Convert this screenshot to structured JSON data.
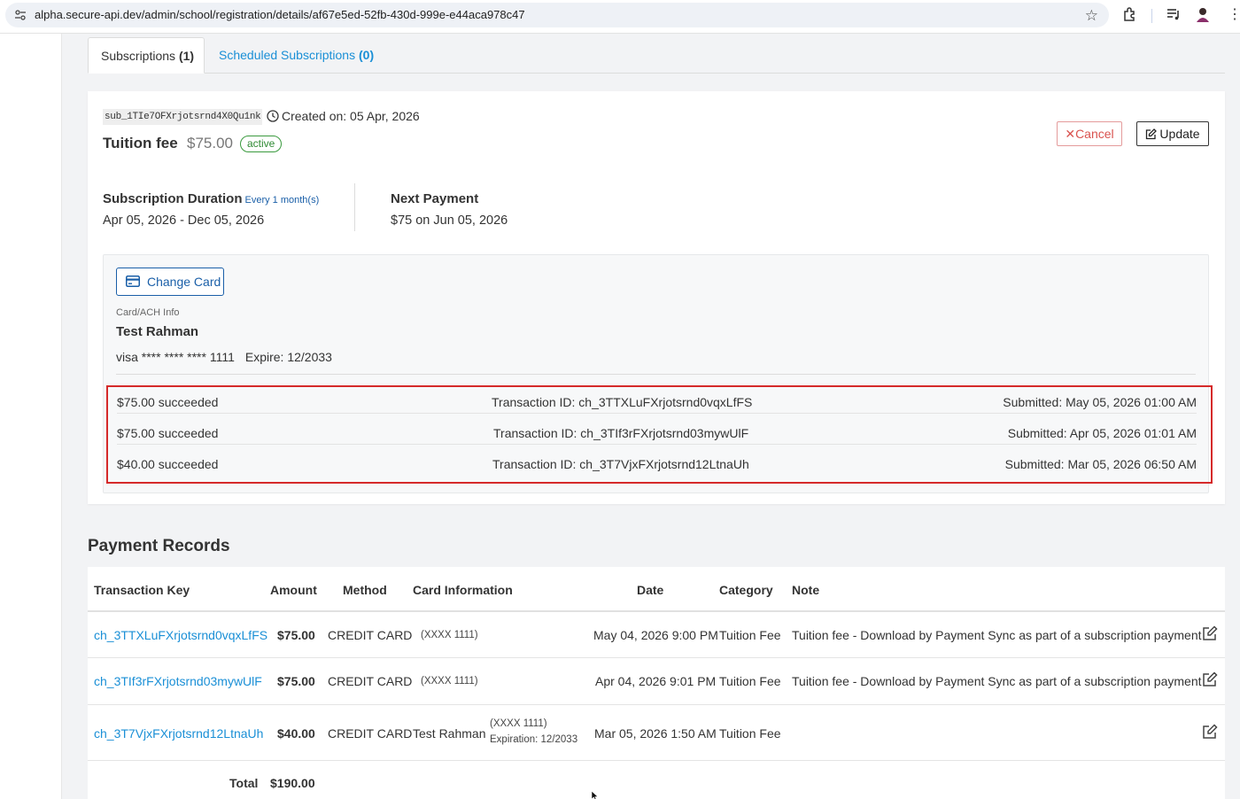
{
  "browser": {
    "url": "alpha.secure-api.dev/admin/school/registration/details/af67e5ed-52fb-430d-999e-e44aca978c47"
  },
  "tabs": [
    {
      "label": "Subscriptions ",
      "count": "(1)"
    },
    {
      "label": "Scheduled Subscriptions ",
      "count": "(0)"
    }
  ],
  "subscription": {
    "id": "sub_1TIe7OFXrjotsrnd4X0Qu1nk",
    "created": "Created on: 05 Apr, 2026",
    "title": "Tuition fee",
    "amount": "$75.00",
    "status": "active",
    "cancel_label": "Cancel",
    "update_label": "Update",
    "duration_label": "Subscription Duration",
    "duration_interval": "Every 1 month(s)",
    "duration_value": "Apr 05, 2026 - Dec 05, 2026",
    "next_label": "Next Payment",
    "next_value": "$75 on Jun 05, 2026",
    "change_card_label": "Change Card",
    "card_info_label": "Card/ACH Info",
    "card_holder": "Test Rahman",
    "card_number": "visa **** **** **** 1111",
    "card_expire": "Expire: 12/2033",
    "transactions": [
      {
        "amount": "$75.00 succeeded",
        "id": "Transaction ID: ch_3TTXLuFXrjotsrnd0vqxLfFS",
        "submitted": "Submitted: May 05, 2026 01:00 AM"
      },
      {
        "amount": "$75.00 succeeded",
        "id": "Transaction ID: ch_3TIf3rFXrjotsrnd03mywUlF",
        "submitted": "Submitted: Apr 05, 2026 01:01 AM"
      },
      {
        "amount": "$40.00 succeeded",
        "id": "Transaction ID: ch_3T7VjxFXrjotsrnd12LtnaUh",
        "submitted": "Submitted: Mar 05, 2026 06:50 AM"
      }
    ]
  },
  "payment_records": {
    "title": "Payment Records",
    "headers": [
      "Transaction Key",
      "Amount",
      "Method",
      "Card Information",
      "Date",
      "Category",
      "Note"
    ],
    "rows": [
      {
        "key": "ch_3TTXLuFXrjotsrnd0vqxLfFS",
        "amount": "$75.00",
        "method": "CREDIT CARD",
        "card_name": "",
        "card_info": "(XXXX 1111)",
        "card_exp": "",
        "date": "May 04, 2026 9:00 PM",
        "category": "Tuition Fee",
        "note": "Tuition fee - Download by Payment Sync as part of a subscription payment"
      },
      {
        "key": "ch_3TIf3rFXrjotsrnd03mywUlF",
        "amount": "$75.00",
        "method": "CREDIT CARD",
        "card_name": "",
        "card_info": "(XXXX 1111)",
        "card_exp": "",
        "date": "Apr 04, 2026 9:01 PM",
        "category": "Tuition Fee",
        "note": "Tuition fee - Download by Payment Sync as part of a subscription payment"
      },
      {
        "key": "ch_3T7VjxFXrjotsrnd12LtnaUh",
        "amount": "$40.00",
        "method": "CREDIT CARD",
        "card_name": "Test Rahman",
        "card_info": "(XXXX 1111)",
        "card_exp": "Expiration: 12/2033",
        "date": "Mar 05, 2026 1:50 AM",
        "category": "Tuition Fee",
        "note": ""
      }
    ],
    "total_label": "Total",
    "total_value": "$190.00"
  },
  "colors": {
    "link": "#1a8fd6",
    "primary": "#1a5fa8",
    "danger": "#d9534f",
    "success": "#2f8a33",
    "highlight": "#d52a2a"
  }
}
